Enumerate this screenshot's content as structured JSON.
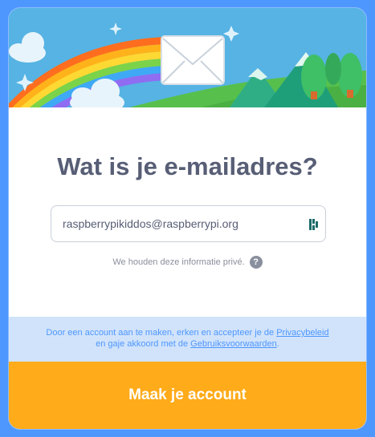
{
  "dialog": {
    "title": "Wat is je e-mailadres?",
    "email_value": "raspberrypikiddos@raspberrypi.org",
    "privacy_note": "We houden deze informatie privé.",
    "help_symbol": "?",
    "terms": {
      "line1_prefix": "Door een account aan te maken, erken en accepteer je de ",
      "privacy_link": "Privacybeleid",
      "line2_prefix": "en gaje akkoord met de ",
      "terms_link": "Gebruiksvoorwaarden",
      "line2_suffix": "."
    },
    "submit_label": "Maak je account"
  },
  "icons": {
    "banner": "rainbow-envelope-illustration",
    "password_manager": "password-manager-icon",
    "help": "question-mark-icon"
  },
  "colors": {
    "frame": "#4d97ff",
    "title": "#575e75",
    "terms_bg": "#d1e3fb",
    "link": "#4d97ff",
    "submit_bg": "#ffab1a"
  }
}
